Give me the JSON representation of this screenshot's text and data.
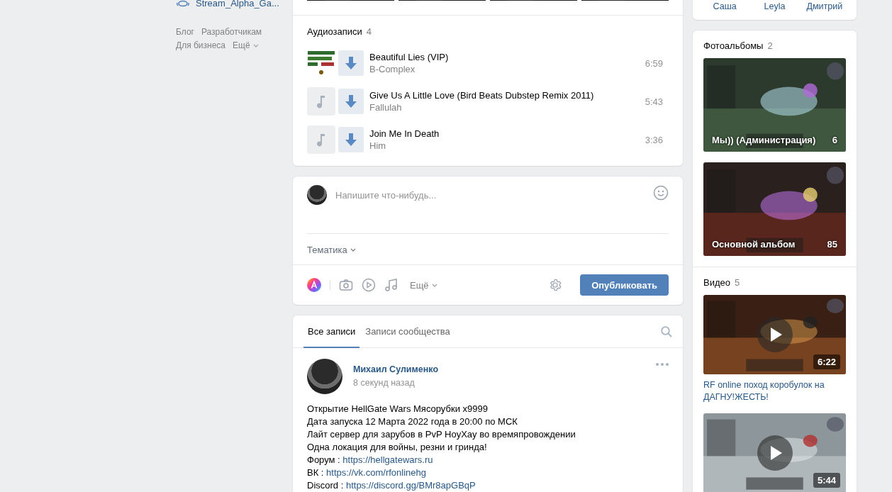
{
  "sidebar": {
    "group_item": "Stream_Alpha_Ga...",
    "footer_links": [
      {
        "label": "Блог",
        "dropdown": false
      },
      {
        "label": "Разработчикам",
        "dropdown": false
      },
      {
        "label": "Для бизнеса",
        "dropdown": false
      },
      {
        "label": "Ещё",
        "dropdown": true
      }
    ]
  },
  "audio": {
    "title": "Аудиозаписи",
    "count": "4",
    "tracks": [
      {
        "kind": "art",
        "title": "Beautiful Lies (VIP)",
        "artist": "B-Complex",
        "duration": "6:59"
      },
      {
        "kind": "note",
        "title": "Give Us A Little Love (Bird Beats Dubstep Remix 2011)",
        "artist": "Fallulah",
        "duration": "5:43"
      },
      {
        "kind": "note",
        "title": "Join Me In Death",
        "artist": "Him",
        "duration": "3:36"
      }
    ]
  },
  "composer": {
    "placeholder": "Напишите что-нибудь...",
    "topic": "Тематика",
    "more": "Ещё",
    "publish": "Опубликовать"
  },
  "wall": {
    "tabs": [
      {
        "label": "Все записи",
        "selected": true
      },
      {
        "label": "Записи сообщества",
        "selected": false
      }
    ],
    "post": {
      "author": "Михаил Сулименко",
      "time": "8 секунд назад",
      "lines": [
        {
          "text": "Открытие HellGate Wars Мясорубки x9999"
        },
        {
          "text": "Дата запуска 12 Марта 2022 года в 20:00 по МСК"
        },
        {
          "text": "Лайт сервер для зарубов в PvP HoyXay во времяпровождении"
        },
        {
          "text": "Одна локация для войны, резни и гринда!"
        },
        {
          "text": "Форум :",
          "link": "https://hellgatewars.ru"
        },
        {
          "text": "ВК :",
          "link": "https://vk.com/rfonlinehg"
        },
        {
          "text": "Discord :",
          "link": "https://discord.gg/BMr8apGBqP"
        }
      ]
    }
  },
  "friends": [
    "Саша",
    "Leyla",
    "Дмитрий"
  ],
  "albums": {
    "title": "Фотоальбомы",
    "count": "2",
    "items": [
      {
        "name": "Мы)) (Администрация)",
        "count": "6"
      },
      {
        "name": "Основной альбом",
        "count": "85"
      }
    ]
  },
  "videos": {
    "title": "Видео",
    "count": "5",
    "items": [
      {
        "duration": "6:22",
        "title": "RF online поход коробулок на ДАГНУ!ЖЕСТЬ!"
      },
      {
        "duration": "5:44"
      }
    ]
  }
}
